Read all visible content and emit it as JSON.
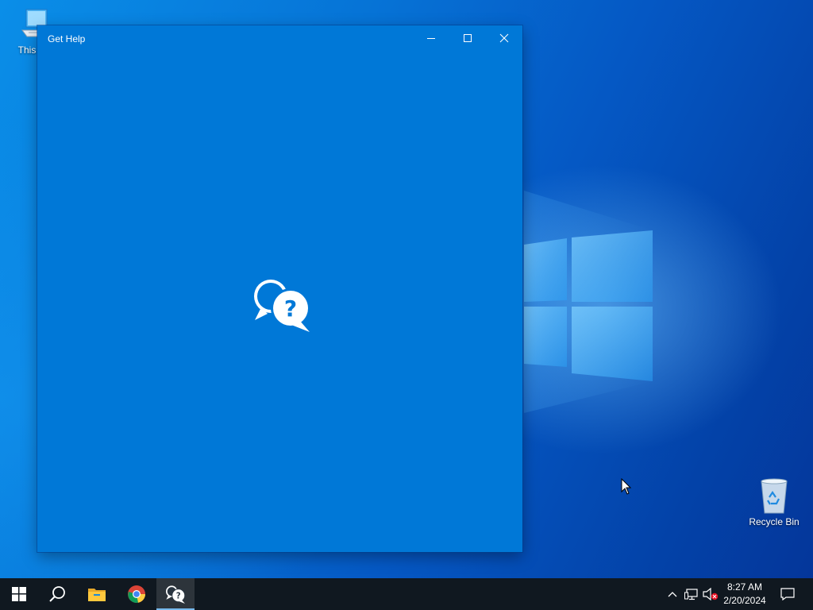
{
  "desktop": {
    "icons": [
      {
        "label": "This PC",
        "icon": "computer-icon"
      },
      {
        "label": "Recycle Bin",
        "icon": "recycle-bin-icon"
      }
    ],
    "colors": {
      "accent": "#0078d7",
      "taskbar": "#101820"
    }
  },
  "window": {
    "title": "Get Help",
    "controls": {
      "minimize": "minimize-icon",
      "maximize": "maximize-icon",
      "close": "close-icon"
    },
    "splash_icon": "get-help-icon"
  },
  "taskbar": {
    "apps": [
      {
        "name": "Start",
        "icon": "windows-start-icon"
      },
      {
        "name": "Search",
        "icon": "search-icon"
      },
      {
        "name": "File Explorer",
        "icon": "folder-icon"
      },
      {
        "name": "Google Chrome",
        "icon": "chrome-icon"
      },
      {
        "name": "Get Help",
        "icon": "get-help-icon",
        "active": true
      }
    ],
    "tray": {
      "icons": [
        "chevron-up-icon",
        "network-icon",
        "volume-muted-icon",
        "notification-icon"
      ],
      "time": "8:27 AM",
      "date": "2/20/2024"
    }
  }
}
